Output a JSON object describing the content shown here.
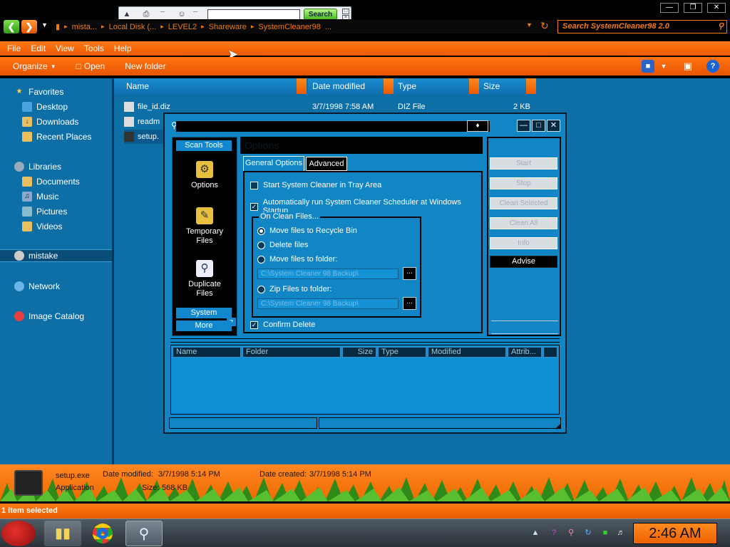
{
  "mini_toolbar": {
    "search_label": "Search",
    "search_value": ""
  },
  "address": {
    "crumbs": [
      "mista...",
      "Local Disk (...",
      "LEVEL2",
      "Shareware",
      "SystemCleaner98",
      "..."
    ],
    "search_placeholder": "Search SystemCleaner98 2.0"
  },
  "menu": [
    "File",
    "Edit",
    "View",
    "Tools",
    "Help"
  ],
  "commands": {
    "organize": "Organize",
    "open": "Open",
    "new_folder": "New folder"
  },
  "nav": {
    "favorites": "Favorites",
    "desktop": "Desktop",
    "downloads": "Downloads",
    "recent": "Recent Places",
    "libraries": "Libraries",
    "documents": "Documents",
    "music": "Music",
    "pictures": "Pictures",
    "videos": "Videos",
    "mistake": "mistake",
    "network": "Network",
    "image_catalog": "Image Catalog"
  },
  "columns": {
    "name": "Name",
    "date": "Date modified",
    "type": "Type",
    "size": "Size"
  },
  "files": [
    {
      "name": "file_id.diz",
      "date": "3/7/1998 7:58 AM",
      "type": "DIZ File",
      "size": "2 KB"
    },
    {
      "name": "readm",
      "date": "",
      "type": "",
      "size": ""
    },
    {
      "name": "setup.",
      "date": "",
      "type": "",
      "size": ""
    }
  ],
  "dialog": {
    "title": "",
    "scan_tools": "Scan Tools",
    "tools": {
      "options": "Options",
      "temp_line1": "Temporary",
      "temp_line2": "Files",
      "dup_line1": "Duplicate",
      "dup_line2": "Files"
    },
    "system": "System",
    "more": "More",
    "options_header": "Options",
    "tab_general": "General Options",
    "tab_advanced": "Advanced",
    "chk_tray": "Start System Cleaner in Tray Area",
    "chk_scheduler": "Automatically run System Cleaner Scheduler at Windows Startup",
    "group_label": "On Clean Files...",
    "radio_recycle": "Move files to Recycle Bin",
    "radio_delete": "Delete files",
    "radio_move": "Move files to folder:",
    "move_path": "C:\\System Cleaner 98 Backup\\",
    "radio_zip": "Zip Files to folder:",
    "zip_path": "C:\\System Cleaner 98 Backup\\",
    "browse": "...",
    "chk_confirm": "Confirm Delete",
    "btn_start": "Start",
    "btn_stop": "Stop",
    "btn_clean_selected": "Clean Selected",
    "btn_clean_all": "Clean All",
    "btn_info": "Info",
    "btn_advise": "Advise",
    "result_cols": {
      "name": "Name",
      "folder": "Folder",
      "size": "Size",
      "type": "Type",
      "modified": "Modified",
      "attrib": "Attrib..."
    }
  },
  "details": {
    "filename": "setup.exe",
    "filetype": "Application",
    "date_modified_label": "Date modified:",
    "date_modified": "3/7/1998 5:14 PM",
    "date_created_label": "Date created:",
    "date_created": "3/7/1998 5:14 PM",
    "size_label": "Size:",
    "size": "568 KB"
  },
  "status": "1 item selected",
  "clock": "2:46 AM"
}
